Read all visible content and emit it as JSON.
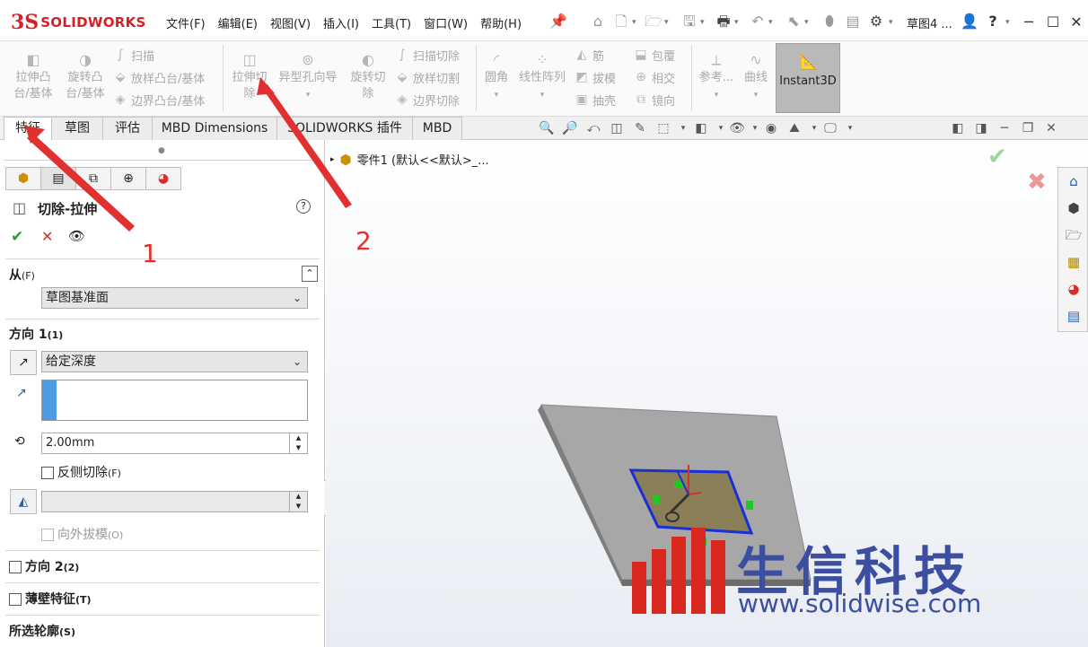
{
  "app": {
    "logo_ds": "3S",
    "logo_text": "SOLIDWORKS",
    "doc_title": "草图4 ...",
    "help_icon": "?"
  },
  "menu": [
    "文件(F)",
    "编辑(E)",
    "视图(V)",
    "插入(I)",
    "工具(T)",
    "窗口(W)",
    "帮助(H)"
  ],
  "features_toolbar": {
    "extrude_boss_line1": "拉伸凸",
    "extrude_boss_line2": "台/基体",
    "revolve_boss_line1": "旋转凸",
    "revolve_boss_line2": "台/基体",
    "sweep": "扫描",
    "loft_boss": "放样凸台/基体",
    "boundary_boss": "边界凸台/基体",
    "extrude_cut_line1": "拉伸切",
    "extrude_cut_line2": "除",
    "hole_wizard": "异型孔向导",
    "revolve_cut_line1": "旋转切",
    "revolve_cut_line2": "除",
    "swept_cut": "扫描切除",
    "lofted_cut": "放样切割",
    "boundary_cut": "边界切除",
    "fillet": "圆角",
    "linear_pattern": "线性阵列",
    "rib": "筋",
    "draft": "拔模",
    "shell": "抽壳",
    "wrap": "包覆",
    "intersect": "相交",
    "mirror": "镜向",
    "reference": "参考...",
    "curves": "曲线",
    "instant3d": "Instant3D"
  },
  "tabs": [
    "特征",
    "草图",
    "评估",
    "MBD Dimensions",
    "SOLIDWORKS 插件",
    "MBD"
  ],
  "property_manager": {
    "title": "切除-拉伸",
    "help": "?",
    "ok": "✔",
    "cancel": "✕",
    "preview": "👁",
    "from_label": "从",
    "from_key": "(F)",
    "from_value": "草图基准面",
    "dir1_label": "方向 1",
    "dir1_key": "(1)",
    "end_condition": "给定深度",
    "depth": "2.00mm",
    "flip_side_label": "反侧切除",
    "flip_side_key": "(F)",
    "draft_outward_label": "向外拔模",
    "draft_outward_key": "(O)",
    "dir2_label": "方向 2",
    "dir2_key": "(2)",
    "thin_label": "薄壁特征",
    "thin_key": "(T)",
    "contours_label": "所选轮廓",
    "contours_key": "(S)"
  },
  "feature_tree": {
    "root": "零件1 (默认<<默认>_..."
  },
  "annotations": {
    "label_1": "1",
    "label_2": "2",
    "color": "#e03030"
  },
  "watermark": {
    "company": "生信科技",
    "url": "www.solidwise.com"
  },
  "colors": {
    "brand_red": "#d81f26",
    "sketch_blue": "#1a2fd8",
    "accept_green": "#28a028",
    "reject_red": "#e04a4a",
    "watermark_blue": "#3b4ea0"
  }
}
